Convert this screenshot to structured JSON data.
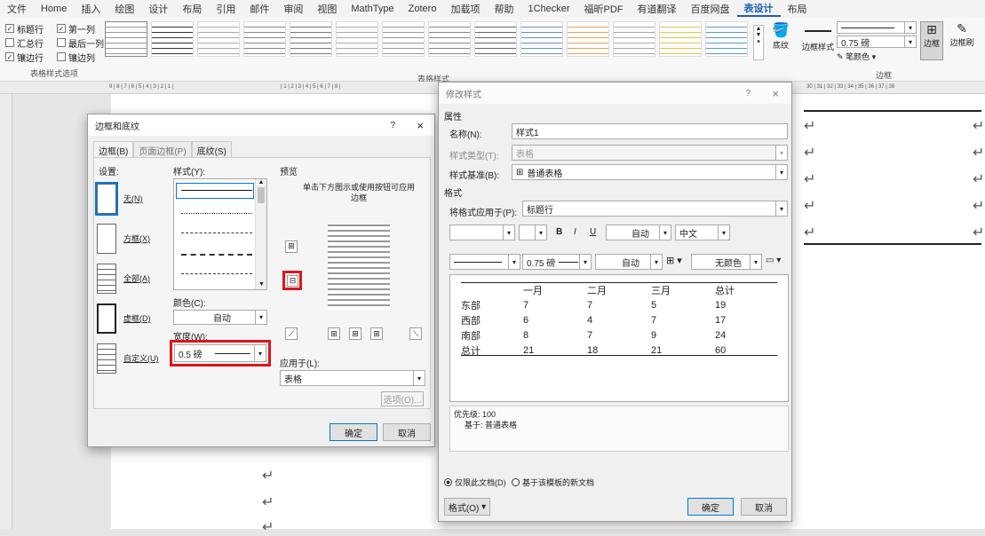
{
  "menu": [
    "文件",
    "Home",
    "插入",
    "绘图",
    "设计",
    "布局",
    "引用",
    "邮件",
    "审阅",
    "视图",
    "MathType",
    "Zotero",
    "加载项",
    "帮助",
    "1Checker",
    "福昕PDF",
    "有道翻译",
    "百度网盘",
    "表设计",
    "布局"
  ],
  "active_menu": "表设计",
  "ribbon": {
    "options": [
      "标题行",
      "第一列",
      "汇总行",
      "最后一列",
      "镶边行",
      "镶边列"
    ],
    "options_checked": [
      true,
      true,
      false,
      false,
      true,
      false
    ],
    "options_group": "表格样式选项",
    "styles_group": "表格样式",
    "shading": "底纹",
    "border_styles": "边框样式",
    "pen_width": "0.75 磅",
    "pen_color": "笔颜色",
    "borders": "边框",
    "border_painter": "边框刷",
    "borders_group": "边框"
  },
  "ruler_text": "9 | 8 | 7 | 6 | 5 | 4 | 3 | 2 | 1 |",
  "ruler_text2": "| 1 | 2 | 3 | 4 | 5 | 6 | 7 | 8 |",
  "ruler_text3": "30 | 31 | 32 | 33 | 34 | 35 | 36 | 37 | 38",
  "border_dialog": {
    "title": "边框和底纹",
    "help": "?",
    "close": "×",
    "tabs": [
      "边框(B)",
      "页面边框(P)",
      "底纹(S)"
    ],
    "setting_label": "设置:",
    "settings": [
      "无(N)",
      "方框(X)",
      "全部(A)",
      "虚框(D)",
      "自定义(U)"
    ],
    "style_label": "样式(Y):",
    "color_label": "颜色(C):",
    "color_value": "自动",
    "width_label": "宽度(W):",
    "width_value": "0.5 磅",
    "preview_label": "预览",
    "preview_hint": "单击下方图示或使用按钮可应用边框",
    "apply_label": "应用于(L):",
    "apply_value": "表格",
    "options_btn": "选项(O)...",
    "ok": "确定",
    "cancel": "取消"
  },
  "modify_dialog": {
    "title": "修改样式",
    "help": "?",
    "close": "×",
    "props_label": "属性",
    "name_label": "名称(N):",
    "name_value": "样式1",
    "type_label": "样式类型(T):",
    "type_value": "表格",
    "based_label": "样式基准(B):",
    "based_value": "普通表格",
    "format_label": "格式",
    "apply_to_label": "将格式应用于(P):",
    "apply_to_value": "标题行",
    "font_color": "自动",
    "font_lang": "中文",
    "bold": "B",
    "italic": "I",
    "underline": "U",
    "line_width": "0.75 磅",
    "line_color": "自动",
    "shade": "无颜色",
    "desc1": "优先级: 100",
    "desc2": "基于: 普通表格",
    "radio1": "仅限此文档(D)",
    "radio2": "基于该模板的新文档",
    "format_btn": "格式(O)",
    "ok": "确定",
    "cancel": "取消"
  },
  "preview_table": {
    "headers": [
      "",
      "一月",
      "二月",
      "三月",
      "总计"
    ],
    "rows": [
      [
        "东部",
        "7",
        "7",
        "5",
        "19"
      ],
      [
        "西部",
        "6",
        "4",
        "7",
        "17"
      ],
      [
        "南部",
        "8",
        "7",
        "9",
        "24"
      ],
      [
        "总计",
        "21",
        "18",
        "21",
        "60"
      ]
    ]
  },
  "return_mark": "↵"
}
